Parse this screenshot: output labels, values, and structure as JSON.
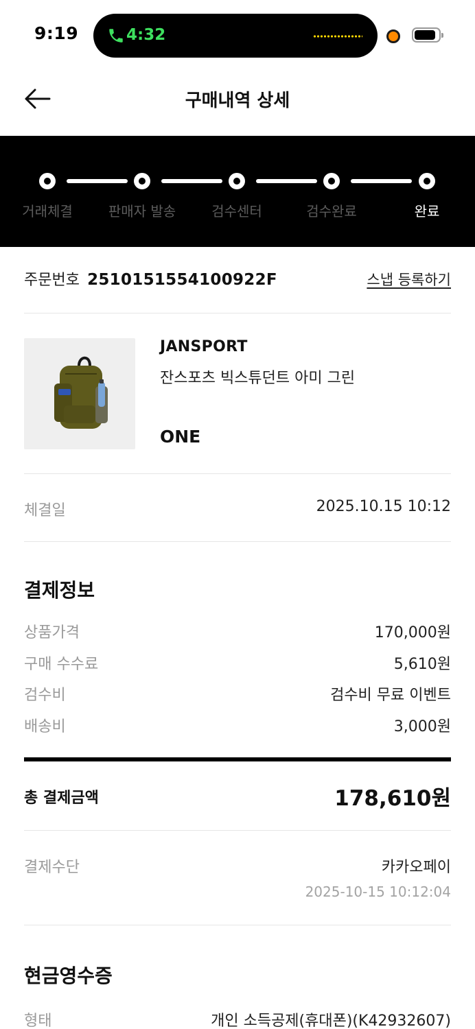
{
  "status_bar": {
    "time": "9:19",
    "call_time": "4:32",
    "icons": [
      "phone-icon",
      "waveform-icon",
      "recording-dot-icon",
      "battery-icon"
    ]
  },
  "header": {
    "title": "구매내역 상세",
    "back_icon": "arrow-left-icon"
  },
  "progress": {
    "steps": [
      "거래체결",
      "판매자 발송",
      "검수센터",
      "검수완료",
      "완료"
    ],
    "current_step": 5
  },
  "order": {
    "label": "주문번호",
    "number": "2510151554100922F",
    "snap_link": "스냅 등록하기"
  },
  "product": {
    "image_icon": "backpack-image",
    "brand": "JANSPORT",
    "name": "잔스포츠 빅스튜던트 아미 그린",
    "size": "ONE"
  },
  "trade": {
    "date_label": "체결일",
    "date_value": "2025.10.15 10:12"
  },
  "payment": {
    "title": "결제정보",
    "rows": [
      {
        "label": "상품가격",
        "value": "170,000원"
      },
      {
        "label": "구매 수수료",
        "value": "5,610원"
      },
      {
        "label": "검수비",
        "value": "검수비 무료 이벤트"
      },
      {
        "label": "배송비",
        "value": "3,000원"
      }
    ],
    "total_label": "총 결제금액",
    "total_value": "178,610원",
    "method_label": "결제수단",
    "method_value": "카카오페이",
    "method_time": "2025-10-15 10:12:04"
  },
  "receipt": {
    "title": "현금영수증",
    "type_label": "형태",
    "type_value": "개인 소득공제(휴대폰)(K42932607)"
  },
  "colors": {
    "accent_dark": "#000000",
    "call_green": "#3ee05f",
    "muted_text": "#9a9a9a",
    "divider": "#e6e6e6"
  }
}
